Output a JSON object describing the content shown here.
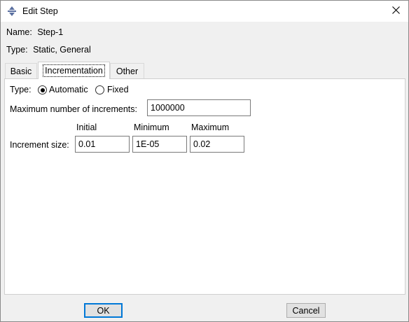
{
  "window": {
    "title": "Edit Step",
    "icons": {
      "app": "step-icon",
      "close": "close-icon"
    }
  },
  "info": {
    "name_label": "Name:",
    "name_value": "Step-1",
    "type_label": "Type:",
    "type_value": "Static, General"
  },
  "tabs": [
    {
      "label": "Basic",
      "active": false
    },
    {
      "label": "Incrementation",
      "active": true
    },
    {
      "label": "Other",
      "active": false
    }
  ],
  "incrementation": {
    "type_label": "Type:",
    "type_options": [
      {
        "label": "Automatic",
        "selected": true
      },
      {
        "label": "Fixed",
        "selected": false
      }
    ],
    "max_increments_label": "Maximum number of increments:",
    "max_increments_value": "1000000",
    "column_headers": {
      "initial": "Initial",
      "minimum": "Minimum",
      "maximum": "Maximum"
    },
    "increment_size_label": "Increment size:",
    "increment_size": {
      "initial": "0.01",
      "minimum": "1E-05",
      "maximum": "0.02"
    }
  },
  "buttons": {
    "ok": "OK",
    "cancel": "Cancel"
  },
  "colors": {
    "default_button_border": "#0078d7",
    "panel_background": "#ffffff",
    "dialog_background": "#f0f0f0"
  }
}
